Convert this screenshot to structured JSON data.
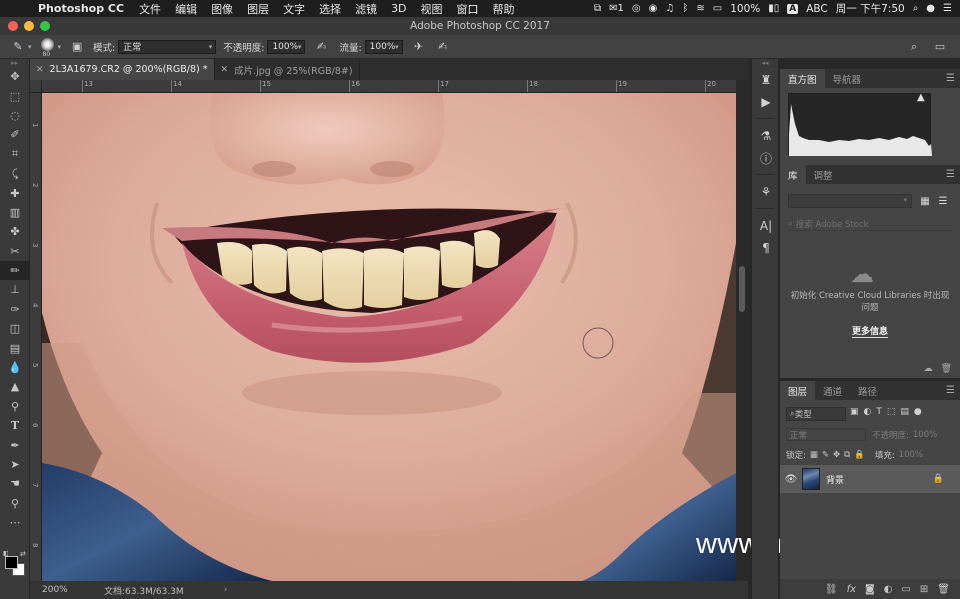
{
  "menubar": {
    "app_name": "Photoshop CC",
    "items": [
      "文件",
      "编辑",
      "图像",
      "图层",
      "文字",
      "选择",
      "滤镜",
      "3D",
      "视图",
      "窗口",
      "帮助"
    ],
    "wechat_badge": "1",
    "battery": "100%",
    "input_source": "A",
    "input_label": "ABC",
    "clock": "周一 下午7:50"
  },
  "window": {
    "title": "Adobe Photoshop CC 2017",
    "colors": {
      "close": "#fc605b",
      "minimize": "#fdbc40",
      "maximize": "#34c84a"
    }
  },
  "options": {
    "brush_size": "80",
    "mode_label": "模式:",
    "mode_value": "正常",
    "opacity_label": "不透明度:",
    "opacity_value": "100%",
    "flow_label": "流量:",
    "flow_value": "100%"
  },
  "tabs": [
    {
      "label": "2L3A1679.CR2 @ 200%(RGB/8) *",
      "active": true
    },
    {
      "label": "成片.jpg @ 25%(RGB/8#)",
      "active": false
    }
  ],
  "rulers": {
    "h_labels": [
      "13",
      "14",
      "15",
      "16",
      "17",
      "18",
      "19",
      "20"
    ],
    "v_labels": [
      "1",
      "2",
      "3",
      "4",
      "5",
      "6",
      "7",
      "8"
    ]
  },
  "tools": [
    "move-icon",
    "marquee-icon",
    "lasso-icon",
    "quick-select-icon",
    "crop-icon",
    "eyedropper-icon",
    "healing-icon",
    "brush-icon-alt",
    "clone-stamp-icon",
    "history-brush-icon",
    "eraser-icon",
    "brush-icon",
    "stamp-icon",
    "smudge-icon",
    "eraser-2-icon",
    "gradient-icon",
    "blur-icon",
    "dodge-icon",
    "pen-icon",
    "type-icon",
    "path-select-icon",
    "hand-icon",
    "zoom-icon",
    "more-icon"
  ],
  "statusbar": {
    "zoom": "200%",
    "doc_info": "文档:63.3M/63.3M"
  },
  "watermark": "www.hunls.com",
  "panels": {
    "histogram": {
      "tabs": [
        "直方图",
        "导航器"
      ]
    },
    "library": {
      "tabs": [
        "库",
        "调整"
      ],
      "search_placeholder": "搜索 Adobe Stock",
      "message": "初始化 Creative Cloud Libraries 时出现问题",
      "more_info": "更多信息"
    },
    "layers": {
      "tabs": [
        "图层",
        "通道",
        "路径"
      ],
      "filter_label": "类型",
      "blend_mode": "正常",
      "opacity_label": "不透明度:",
      "opacity_value": "100%",
      "lock_label": "锁定:",
      "fill_label": "填充:",
      "fill_value": "100%",
      "layer_name": "背景"
    }
  }
}
